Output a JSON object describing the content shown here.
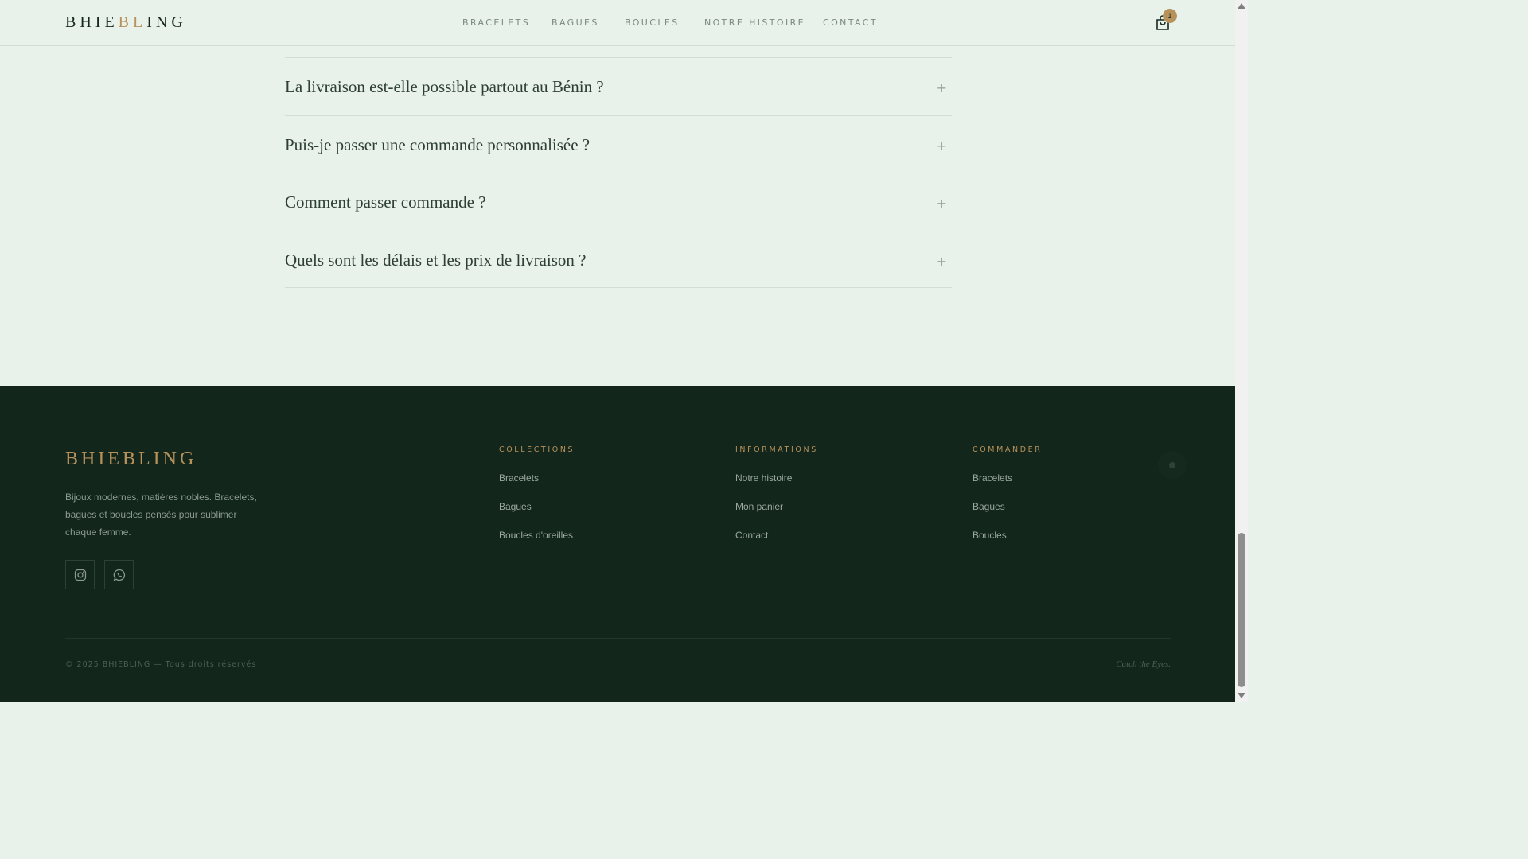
{
  "header": {
    "logo": {
      "part1": "BHIE",
      "part2": "BL",
      "part3": "ING"
    },
    "nav": [
      "BRACELETS",
      "BAGUES",
      "BOUCLES",
      "NOTRE HISTOIRE",
      "CONTACT"
    ],
    "cart_count": "1"
  },
  "faq": [
    "La livraison est-elle possible partout au Bénin ?",
    "Puis-je passer une commande personnalisée ?",
    "Comment passer commande ?",
    "Quels sont les délais et les prix de livraison ?"
  ],
  "faq_toggle": "+",
  "footer": {
    "logo": "BHIEBLING",
    "description": "Bijoux modernes, matières nobles. Bracelets, bagues et boucles pensés pour sublimer chaque femme.",
    "social": [
      "instagram-icon",
      "whatsapp-icon"
    ],
    "columns": [
      {
        "title": "COLLECTIONS",
        "links": [
          "Bracelets",
          "Bagues",
          "Boucles d'oreilles"
        ]
      },
      {
        "title": "INFORMATIONS",
        "links": [
          "Notre histoire",
          "Mon panier",
          "Contact"
        ]
      },
      {
        "title": "COMMANDER",
        "links": [
          "Bracelets",
          "Bagues",
          "Boucles"
        ]
      }
    ],
    "copyright": "© 2025 BHIEBLING — Tous droits réservés",
    "tagline": "Catch the Eyes."
  },
  "colors": {
    "background": "#e8f2ea",
    "footer": "#13261c",
    "gold": "#b7925a",
    "text_dark": "#2e3f34"
  }
}
